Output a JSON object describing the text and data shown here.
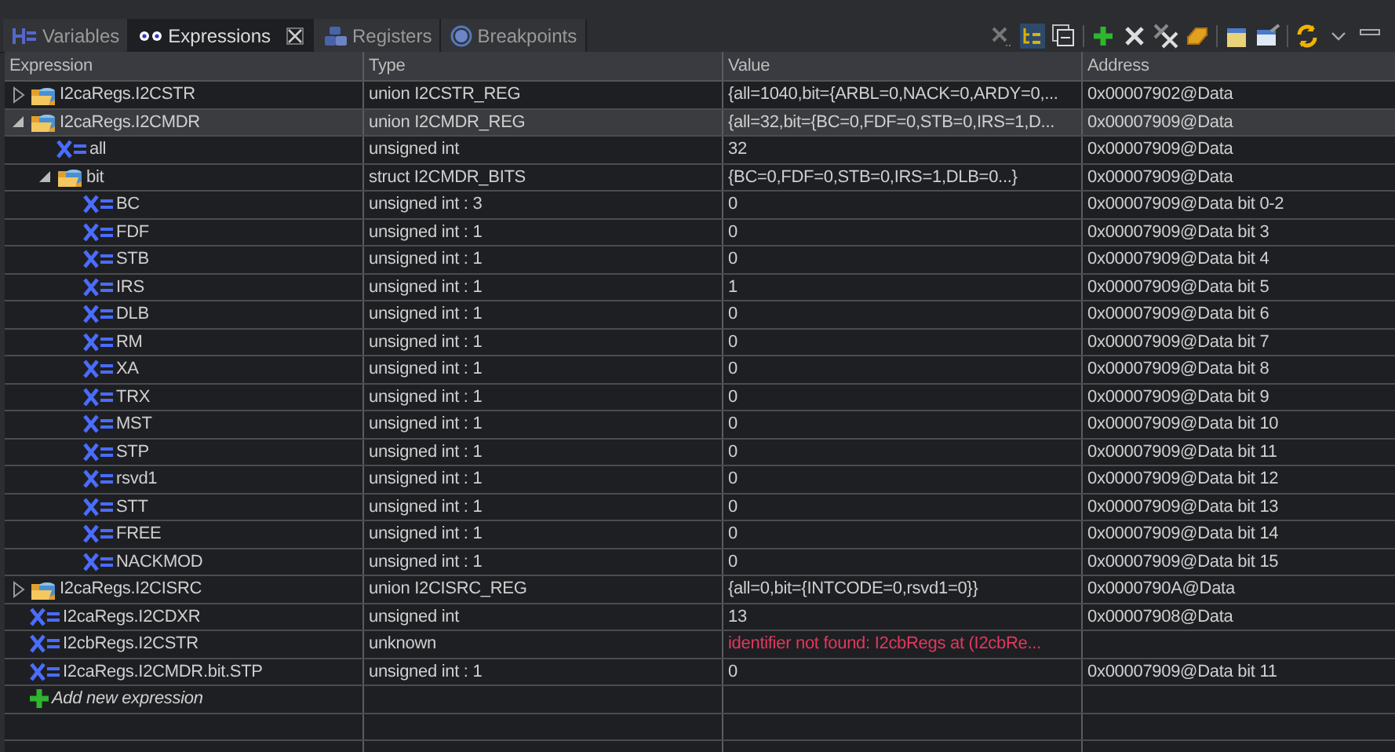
{
  "tabs": [
    {
      "label": "Variables",
      "kind": "variables",
      "selected": false,
      "closable": false
    },
    {
      "label": "Expressions",
      "kind": "expressions",
      "selected": true,
      "closable": true
    },
    {
      "label": "Registers",
      "kind": "registers",
      "selected": false,
      "closable": false
    },
    {
      "label": "Breakpoints",
      "kind": "breakpoints",
      "selected": false,
      "closable": false
    }
  ],
  "table": {
    "columns": [
      "Expression",
      "Type",
      "Value",
      "Address"
    ],
    "rows": [
      {
        "kind": "struct",
        "expression": "I2caRegs.I2CSTR",
        "type": "union I2CSTR_REG",
        "value": "{all=1040,bit={ARBL=0,NACK=0,ARDY=0,...",
        "address": "0x00007902@Data",
        "expanded": false,
        "selected": false,
        "error": false
      },
      {
        "kind": "struct",
        "expression": "I2caRegs.I2CMDR",
        "type": "union I2CMDR_REG",
        "value": "{all=32,bit={BC=0,FDF=0,STB=0,IRS=1,D...",
        "address": "0x00007909@Data",
        "expanded": true,
        "selected": true,
        "error": false,
        "children": [
          {
            "kind": "variable",
            "expression": "all",
            "type": "unsigned int",
            "value": "32",
            "address": "0x00007909@Data",
            "selected": false,
            "error": false
          },
          {
            "kind": "struct",
            "expression": "bit",
            "type": "struct I2CMDR_BITS",
            "value": "{BC=0,FDF=0,STB=0,IRS=1,DLB=0...}",
            "address": "0x00007909@Data",
            "expanded": true,
            "selected": false,
            "error": false,
            "children": [
              {
                "kind": "variable",
                "expression": "BC",
                "type": "unsigned int : 3",
                "value": "0",
                "address": "0x00007909@Data bit 0-2",
                "selected": false,
                "error": false
              },
              {
                "kind": "variable",
                "expression": "FDF",
                "type": "unsigned int : 1",
                "value": "0",
                "address": "0x00007909@Data bit 3",
                "selected": false,
                "error": false
              },
              {
                "kind": "variable",
                "expression": "STB",
                "type": "unsigned int : 1",
                "value": "0",
                "address": "0x00007909@Data bit 4",
                "selected": false,
                "error": false
              },
              {
                "kind": "variable",
                "expression": "IRS",
                "type": "unsigned int : 1",
                "value": "1",
                "address": "0x00007909@Data bit 5",
                "selected": false,
                "error": false
              },
              {
                "kind": "variable",
                "expression": "DLB",
                "type": "unsigned int : 1",
                "value": "0",
                "address": "0x00007909@Data bit 6",
                "selected": false,
                "error": false
              },
              {
                "kind": "variable",
                "expression": "RM",
                "type": "unsigned int : 1",
                "value": "0",
                "address": "0x00007909@Data bit 7",
                "selected": false,
                "error": false
              },
              {
                "kind": "variable",
                "expression": "XA",
                "type": "unsigned int : 1",
                "value": "0",
                "address": "0x00007909@Data bit 8",
                "selected": false,
                "error": false
              },
              {
                "kind": "variable",
                "expression": "TRX",
                "type": "unsigned int : 1",
                "value": "0",
                "address": "0x00007909@Data bit 9",
                "selected": false,
                "error": false
              },
              {
                "kind": "variable",
                "expression": "MST",
                "type": "unsigned int : 1",
                "value": "0",
                "address": "0x00007909@Data bit 10",
                "selected": false,
                "error": false
              },
              {
                "kind": "variable",
                "expression": "STP",
                "type": "unsigned int : 1",
                "value": "0",
                "address": "0x00007909@Data bit 11",
                "selected": false,
                "error": false
              },
              {
                "kind": "variable",
                "expression": "rsvd1",
                "type": "unsigned int : 1",
                "value": "0",
                "address": "0x00007909@Data bit 12",
                "selected": false,
                "error": false
              },
              {
                "kind": "variable",
                "expression": "STT",
                "type": "unsigned int : 1",
                "value": "0",
                "address": "0x00007909@Data bit 13",
                "selected": false,
                "error": false
              },
              {
                "kind": "variable",
                "expression": "FREE",
                "type": "unsigned int : 1",
                "value": "0",
                "address": "0x00007909@Data bit 14",
                "selected": false,
                "error": false
              },
              {
                "kind": "variable",
                "expression": "NACKMOD",
                "type": "unsigned int : 1",
                "value": "0",
                "address": "0x00007909@Data bit 15",
                "selected": false,
                "error": false
              }
            ]
          }
        ]
      },
      {
        "kind": "struct",
        "expression": "I2caRegs.I2CISRC",
        "type": "union I2CISRC_REG",
        "value": "{all=0,bit={INTCODE=0,rsvd1=0}}",
        "address": "0x0000790A@Data",
        "expanded": false,
        "selected": false,
        "error": false
      },
      {
        "kind": "variable",
        "expression": "I2caRegs.I2CDXR",
        "type": "unsigned int",
        "value": "13",
        "address": "0x00007908@Data",
        "selected": false,
        "error": false
      },
      {
        "kind": "variable",
        "expression": "I2cbRegs.I2CSTR",
        "type": "unknown",
        "value": "identifier not found: I2cbRegs at (I2cbRe...",
        "address": "",
        "selected": false,
        "error": true
      },
      {
        "kind": "variable",
        "expression": "I2caRegs.I2CMDR.bit.STP",
        "type": "unsigned int : 1",
        "value": "0",
        "address": "0x00007909@Data bit 11",
        "selected": false,
        "error": false
      }
    ],
    "add_row": {
      "label": "Add new expression"
    }
  }
}
